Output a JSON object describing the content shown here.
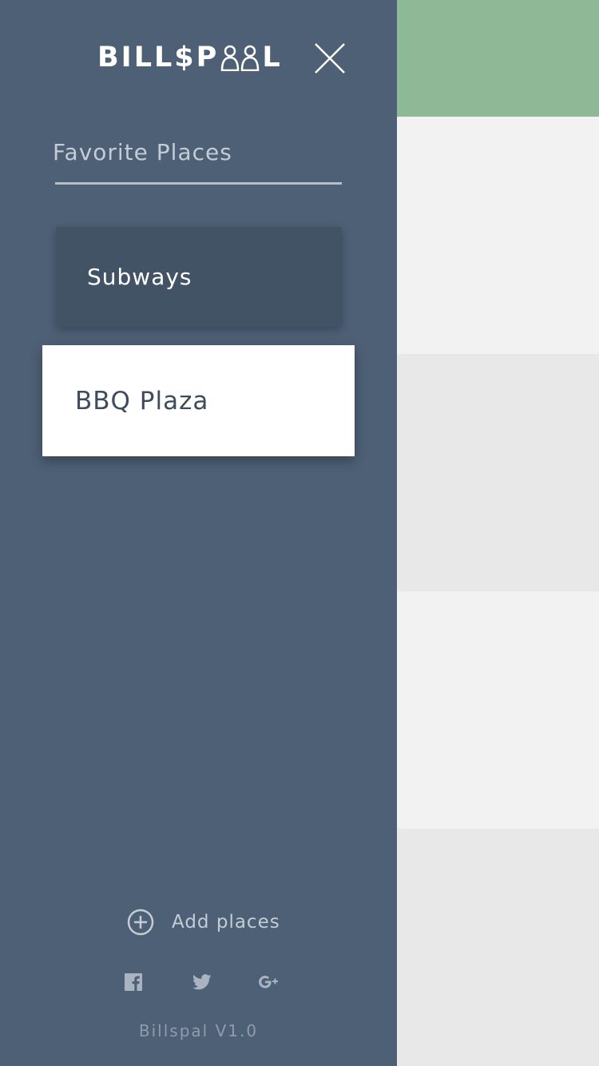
{
  "app": {
    "logo_text_left": "BILL$P",
    "logo_text_right": "L",
    "close_icon": "close-icon"
  },
  "drawer": {
    "section_title": "Favorite Places",
    "places": [
      {
        "label": "Subways",
        "state": "default"
      },
      {
        "label": "BBQ Plaza",
        "state": "selected"
      }
    ],
    "add_places_label": "Add places",
    "social": [
      "facebook-icon",
      "twitter-icon",
      "google-plus-icon"
    ],
    "version": "Billspal V1.0"
  },
  "colors": {
    "drawer_bg": "#4e6076",
    "item_bg": "#435366",
    "selected_bg": "#ffffff",
    "header_accent": "#8fb996",
    "muted_text": "#c4ccd6"
  }
}
